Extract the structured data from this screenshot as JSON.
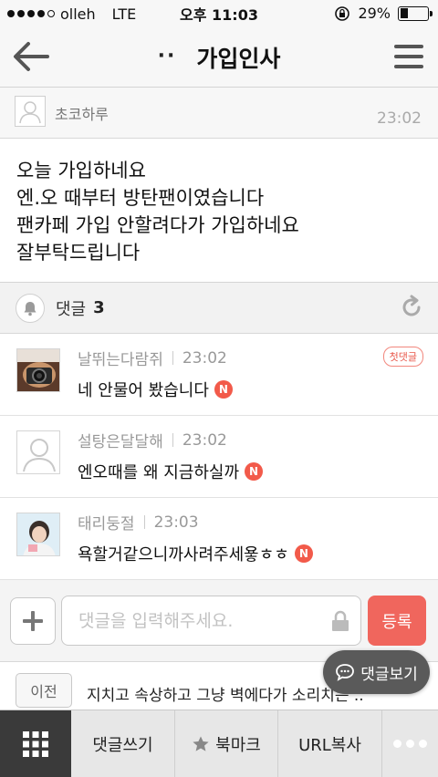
{
  "status_bar": {
    "carrier": "olleh",
    "network": "LTE",
    "time": "오후 11:03",
    "battery": "29%",
    "battery_level": 0.29
  },
  "header": {
    "dots": "··",
    "title": "가입인사"
  },
  "post": {
    "author": "초코하루",
    "time": "23:02",
    "lines": [
      "오늘 가입하네요",
      "엔.오 때부터 방탄팬이였습니다",
      "팬카페 가입 안할려다가 가입하네요",
      "잘부탁드립니다"
    ]
  },
  "comments_header": {
    "label": "댓글",
    "count": "3"
  },
  "comments": [
    {
      "author": "날뛰는다람쥐",
      "time": "23:02",
      "text": "네 안물어 봤습니다",
      "new_badge": "N",
      "first_badge": "첫댓글"
    },
    {
      "author": "설탕은달달해",
      "time": "23:02",
      "text": "엔오때를 왜 지금하실까",
      "new_badge": "N"
    },
    {
      "author": "태리둥절",
      "time": "23:03",
      "text": "욕할거같으니까사려주세욯ㅎㅎ",
      "new_badge": "N"
    }
  ],
  "comment_input": {
    "placeholder": "댓글을 입력해주세요.",
    "submit_label": "등록"
  },
  "prev_post": {
    "button_label": "이전",
    "title": "지치고 속상하고 그냥 벽에다가 소리치는 .."
  },
  "floating": {
    "view_comments_label": "댓글보기"
  },
  "toolbar": {
    "write_comment": "댓글쓰기",
    "bookmark": "북마크",
    "copy_url": "URL복사"
  },
  "colors": {
    "accent": "#f0665d",
    "badge": "#f25a4a",
    "toolbar_dark": "#3a3a3a"
  }
}
